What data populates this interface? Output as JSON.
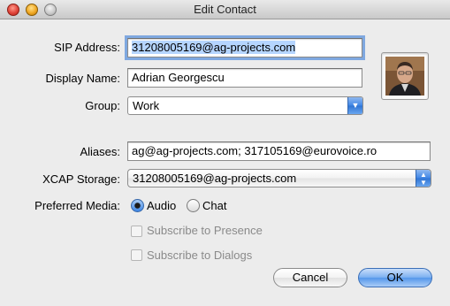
{
  "window": {
    "title": "Edit Contact"
  },
  "form": {
    "sip_label": "SIP Address:",
    "sip_value": "31208005169@ag-projects.com",
    "display_label": "Display Name:",
    "display_value": "Adrian Georgescu",
    "group_label": "Group:",
    "group_value": "Work",
    "aliases_label": "Aliases:",
    "aliases_value": "ag@ag-projects.com; 317105169@eurovoice.ro",
    "xcap_label": "XCAP Storage:",
    "xcap_value": "31208005169@ag-projects.com",
    "media_label": "Preferred Media:",
    "media_audio": "Audio",
    "media_chat": "Chat",
    "media_selected": "Audio",
    "subscribe_presence": "Subscribe to Presence",
    "subscribe_dialogs": "Subscribe to Dialogs"
  },
  "buttons": {
    "cancel": "Cancel",
    "ok": "OK"
  },
  "colors": {
    "accent": "#3d86e5",
    "focus_ring": "#7fa8e0",
    "selection": "#b5d5ff"
  },
  "icons": {
    "popup_arrow": "chevron-down-icon",
    "stepper_arrows": "up-down-chevron-icon"
  }
}
